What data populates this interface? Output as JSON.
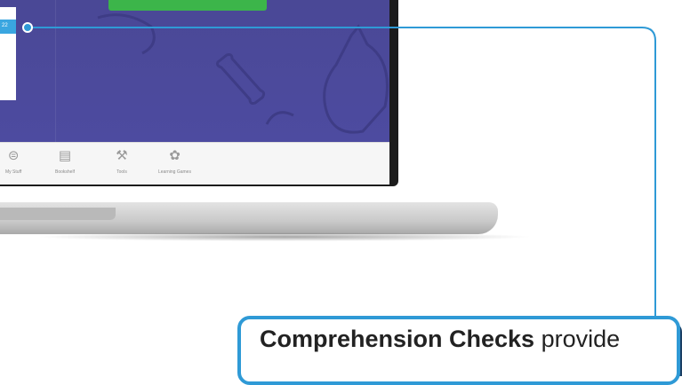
{
  "screen": {
    "left_panel_tag": "22",
    "toolbar": [
      {
        "label": "My Stuff",
        "icon": "my-stuff-icon"
      },
      {
        "label": "Bookshelf",
        "icon": "bookshelf-icon"
      },
      {
        "label": "Tools",
        "icon": "tools-icon"
      },
      {
        "label": "Learning Games",
        "icon": "learning-games-icon"
      }
    ]
  },
  "callout": {
    "title": "Comprehension Checks",
    "text": " provide"
  },
  "colors": {
    "accent": "#2f9ad6",
    "screen_bg": "#4b4a9a",
    "green_button": "#3cb54a"
  }
}
